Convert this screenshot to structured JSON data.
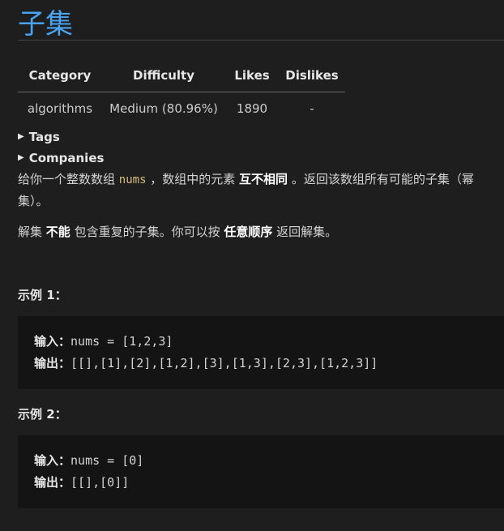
{
  "title": "子集",
  "meta_table": {
    "headers": [
      "Category",
      "Difficulty",
      "Likes",
      "Dislikes"
    ],
    "row": [
      "algorithms",
      "Medium (80.96%)",
      "1890",
      "-"
    ]
  },
  "sections": {
    "tags": "Tags",
    "companies": "Companies"
  },
  "description": {
    "p1_part1": "给你一个整数数组 ",
    "p1_code": "nums",
    "p1_part2": " ，数组中的元素 ",
    "p1_bold": "互不相同",
    "p1_part3": " 。返回该数组所有可能的子集（幂集）。",
    "p2_part1": "解集 ",
    "p2_bold1": "不能",
    "p2_part2": " 包含重复的子集。你可以按 ",
    "p2_bold2": "任意顺序",
    "p2_part3": " 返回解集。"
  },
  "examples": [
    {
      "heading": "示例 1：",
      "input_label": "输入：",
      "input_value": "nums = [1,2,3]",
      "output_label": "输出：",
      "output_value": "[[],[1],[2],[1,2],[3],[1,3],[2,3],[1,2,3]]"
    },
    {
      "heading": "示例 2：",
      "input_label": "输入：",
      "input_value": "nums = [0]",
      "output_label": "输出：",
      "output_value": "[[],[0]]"
    }
  ]
}
